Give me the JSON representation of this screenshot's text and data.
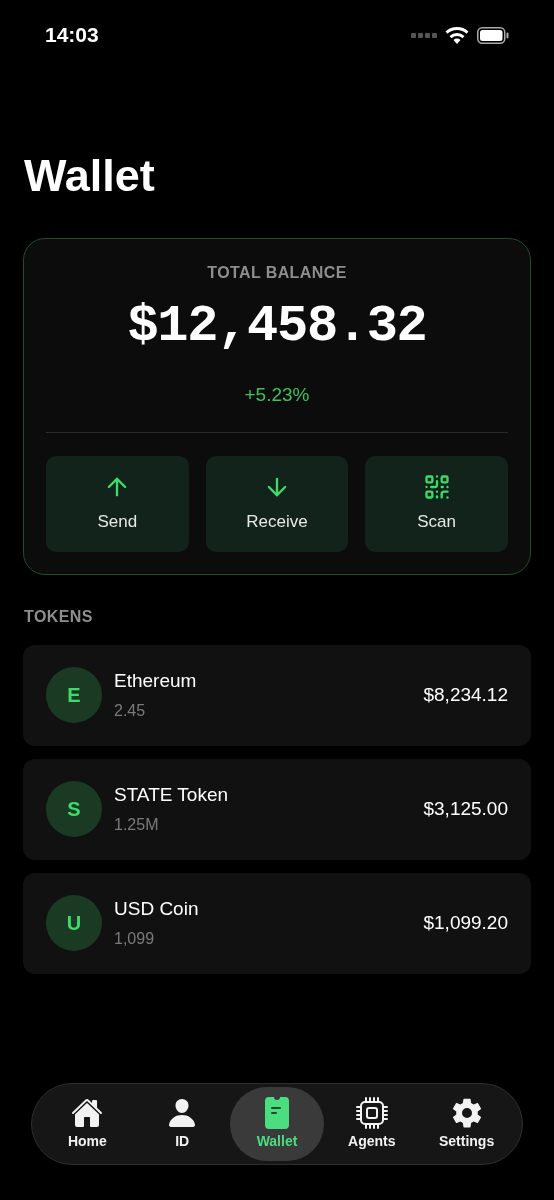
{
  "status_bar": {
    "time": "14:03"
  },
  "title": "Wallet",
  "balance": {
    "label": "TOTAL BALANCE",
    "amount": "$12,458.32",
    "change": "+5.23%",
    "actions": [
      {
        "kind": "send",
        "label": "Send"
      },
      {
        "kind": "receive",
        "label": "Receive"
      },
      {
        "kind": "scan",
        "label": "Scan"
      }
    ]
  },
  "tokens": {
    "heading": "TOKENS",
    "items": [
      {
        "initial": "E",
        "name": "Ethereum",
        "amount": "2.45",
        "value": "$8,234.12"
      },
      {
        "initial": "S",
        "name": "STATE Token",
        "amount": "1.25M",
        "value": "$3,125.00"
      },
      {
        "initial": "U",
        "name": "USD Coin",
        "amount": "1,099",
        "value": "$1,099.20"
      }
    ]
  },
  "tab_bar": [
    {
      "kind": "home",
      "label": "Home",
      "selected": false
    },
    {
      "kind": "id",
      "label": "ID",
      "selected": false
    },
    {
      "kind": "wallet",
      "label": "Wallet",
      "selected": true
    },
    {
      "kind": "agents",
      "label": "Agents",
      "selected": false
    },
    {
      "kind": "settings",
      "label": "Settings",
      "selected": false
    }
  ]
}
